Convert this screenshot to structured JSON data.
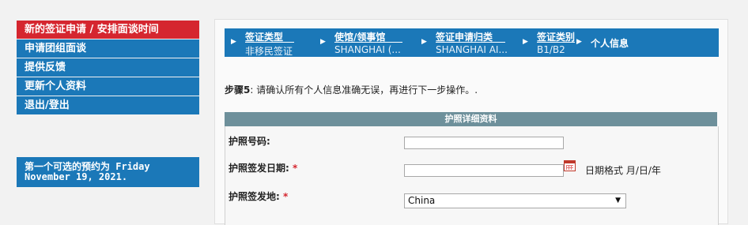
{
  "sidebar": {
    "items": [
      {
        "label": "新的签证申请 / 安排面谈时间",
        "active": true
      },
      {
        "label": "申请团组面谈",
        "active": false
      },
      {
        "label": "提供反馈",
        "active": false
      },
      {
        "label": "更新个人资料",
        "active": false
      },
      {
        "label": "退出/登出",
        "active": false
      }
    ],
    "appointment": "第一个可选的预约为 Friday November 19, 2021."
  },
  "steps": [
    {
      "label": "签证类型",
      "value": "非移民签证"
    },
    {
      "label": "使馆/领事馆",
      "value": "SHANGHAI (..."
    },
    {
      "label": "签证申请归类",
      "value": "SHANGHAI AI..."
    },
    {
      "label": "签证类别",
      "value": "B1/B2"
    },
    {
      "label": "个人信息",
      "value": ""
    }
  ],
  "instruction": {
    "step": "步骤5",
    "text": ": 请确认所有个人信息准确无误，再进行下一步操作。."
  },
  "section": {
    "title": "护照详细资料"
  },
  "form": {
    "passport_number_label": "护照号码:",
    "passport_number_value": "",
    "issue_date_label": "护照签发日期:",
    "issue_date_value": "",
    "date_format_hint": "日期格式 月/日/年",
    "issue_place_label": "护照签发地:",
    "issue_place_value": "China",
    "required_mark": "*"
  },
  "colors": {
    "accent_blue": "#1b78b8",
    "active_red": "#d5262f",
    "section_gray": "#6e909b"
  }
}
